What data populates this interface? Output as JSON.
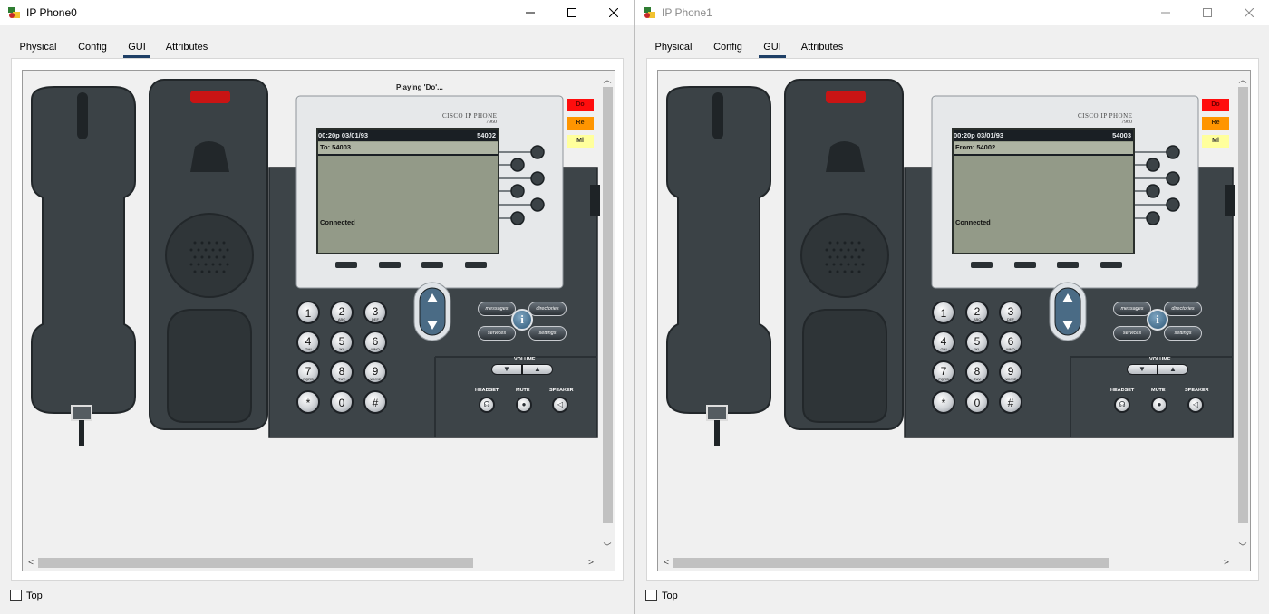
{
  "windows": [
    {
      "title": "IP Phone0",
      "tabs": [
        "Physical",
        "Config",
        "GUI",
        "Attributes"
      ],
      "active_tab": "GUI",
      "status_banner": "Playing 'Do'...",
      "phone": {
        "brand": "CISCO IP PHONE",
        "model": "7960",
        "lcd_time": "00:20p 03/01/93",
        "lcd_extension": "54002",
        "lcd_line": "To: 54003",
        "lcd_status": "Connected",
        "side_buttons": [
          "Do",
          "Re",
          "Ml"
        ]
      },
      "top_checkbox_label": "Top",
      "top_checked": false
    },
    {
      "title": "IP Phone1",
      "tabs": [
        "Physical",
        "Config",
        "GUI",
        "Attributes"
      ],
      "active_tab": "GUI",
      "status_banner": "",
      "phone": {
        "brand": "CISCO IP PHONE",
        "model": "7960",
        "lcd_time": "00:20p 03/01/93",
        "lcd_extension": "54003",
        "lcd_line": "From: 54002",
        "lcd_status": "Connected",
        "side_buttons": [
          "Do",
          "Re",
          "Ml"
        ]
      },
      "top_checkbox_label": "Top",
      "top_checked": false
    }
  ],
  "keypad": [
    {
      "num": "1",
      "sub": ""
    },
    {
      "num": "2",
      "sub": "ABC"
    },
    {
      "num": "3",
      "sub": "DEF"
    },
    {
      "num": "4",
      "sub": "GHI"
    },
    {
      "num": "5",
      "sub": "JKL"
    },
    {
      "num": "6",
      "sub": "MNO"
    },
    {
      "num": "7",
      "sub": "PQRS"
    },
    {
      "num": "8",
      "sub": "TUV"
    },
    {
      "num": "9",
      "sub": "WXYZ"
    },
    {
      "num": "*",
      "sub": ""
    },
    {
      "num": "0",
      "sub": ""
    },
    {
      "num": "#",
      "sub": ""
    }
  ],
  "function_keys": {
    "messages": "messages",
    "directories": "directories",
    "services": "services",
    "settings": "settings",
    "info": "i",
    "volume": "VOLUME",
    "headset": "HEADSET",
    "mute": "MUTE",
    "speaker": "SPEAKER"
  },
  "colors": {
    "titlebar": "#ffffff",
    "tab_underline": "#1e3f66",
    "lcd_background": "#939a88",
    "phone_body": "#3d4448",
    "side_red": "#ff0d0d",
    "side_orange": "#ff9500",
    "side_yellow": "#ffff9c"
  }
}
